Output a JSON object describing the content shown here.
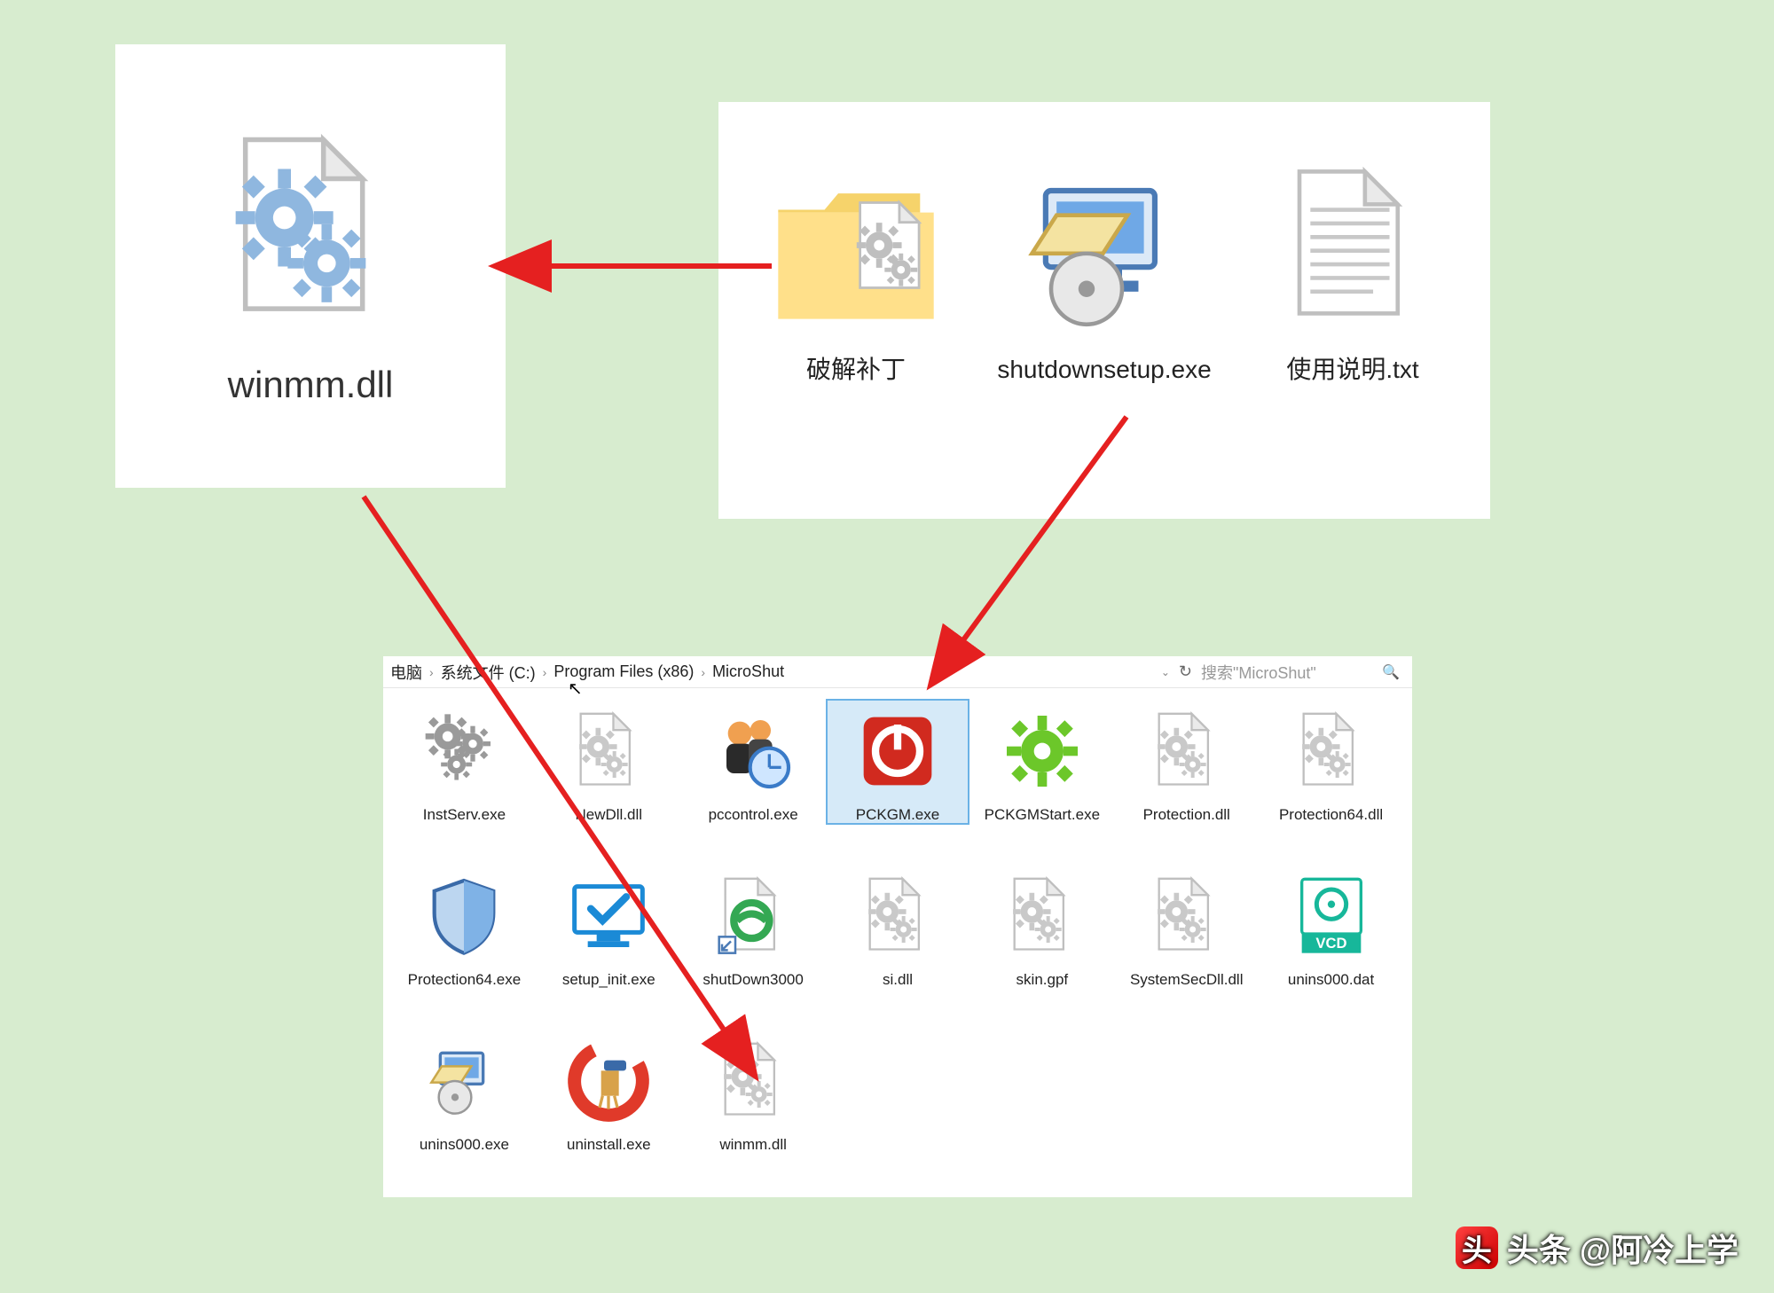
{
  "dll_panel": {
    "label": "winmm.dll"
  },
  "source_panel": {
    "items": [
      {
        "label": "破解补丁",
        "icon": "folder-with-file"
      },
      {
        "label": "shutdownsetup.exe",
        "icon": "installer"
      },
      {
        "label": "使用说明.txt",
        "icon": "text-file"
      }
    ]
  },
  "explorer": {
    "breadcrumb": [
      "电脑",
      "系统文件 (C:)",
      "Program Files (x86)",
      "MicroShut"
    ],
    "search_placeholder": "搜索\"MicroShut\"",
    "files": [
      {
        "label": "InstServ.exe",
        "icon": "gears-gray",
        "selected": false
      },
      {
        "label": "NewDll.dll",
        "icon": "dll",
        "selected": false
      },
      {
        "label": "pccontrol.exe",
        "icon": "people-clock",
        "selected": false
      },
      {
        "label": "PCKGM.exe",
        "icon": "power-red",
        "selected": true
      },
      {
        "label": "PCKGMStart.exe",
        "icon": "gear-green",
        "selected": false
      },
      {
        "label": "Protection.dll",
        "icon": "dll",
        "selected": false
      },
      {
        "label": "Protection64.dll",
        "icon": "dll",
        "selected": false
      },
      {
        "label": "Protection64.exe",
        "icon": "shield",
        "selected": false
      },
      {
        "label": "setup_init.exe",
        "icon": "monitor-check",
        "selected": false
      },
      {
        "label": "shutDown3000",
        "icon": "ie-shortcut",
        "selected": false
      },
      {
        "label": "si.dll",
        "icon": "dll",
        "selected": false
      },
      {
        "label": "skin.gpf",
        "icon": "dll",
        "selected": false
      },
      {
        "label": "SystemSecDll.dll",
        "icon": "dll",
        "selected": false
      },
      {
        "label": "unins000.dat",
        "icon": "vcd",
        "selected": false
      },
      {
        "label": "unins000.exe",
        "icon": "installer-sm",
        "selected": false
      },
      {
        "label": "uninstall.exe",
        "icon": "ccleaner",
        "selected": false
      },
      {
        "label": "winmm.dll",
        "icon": "dll",
        "selected": false
      }
    ]
  },
  "credit": "头条 @阿冷上学"
}
